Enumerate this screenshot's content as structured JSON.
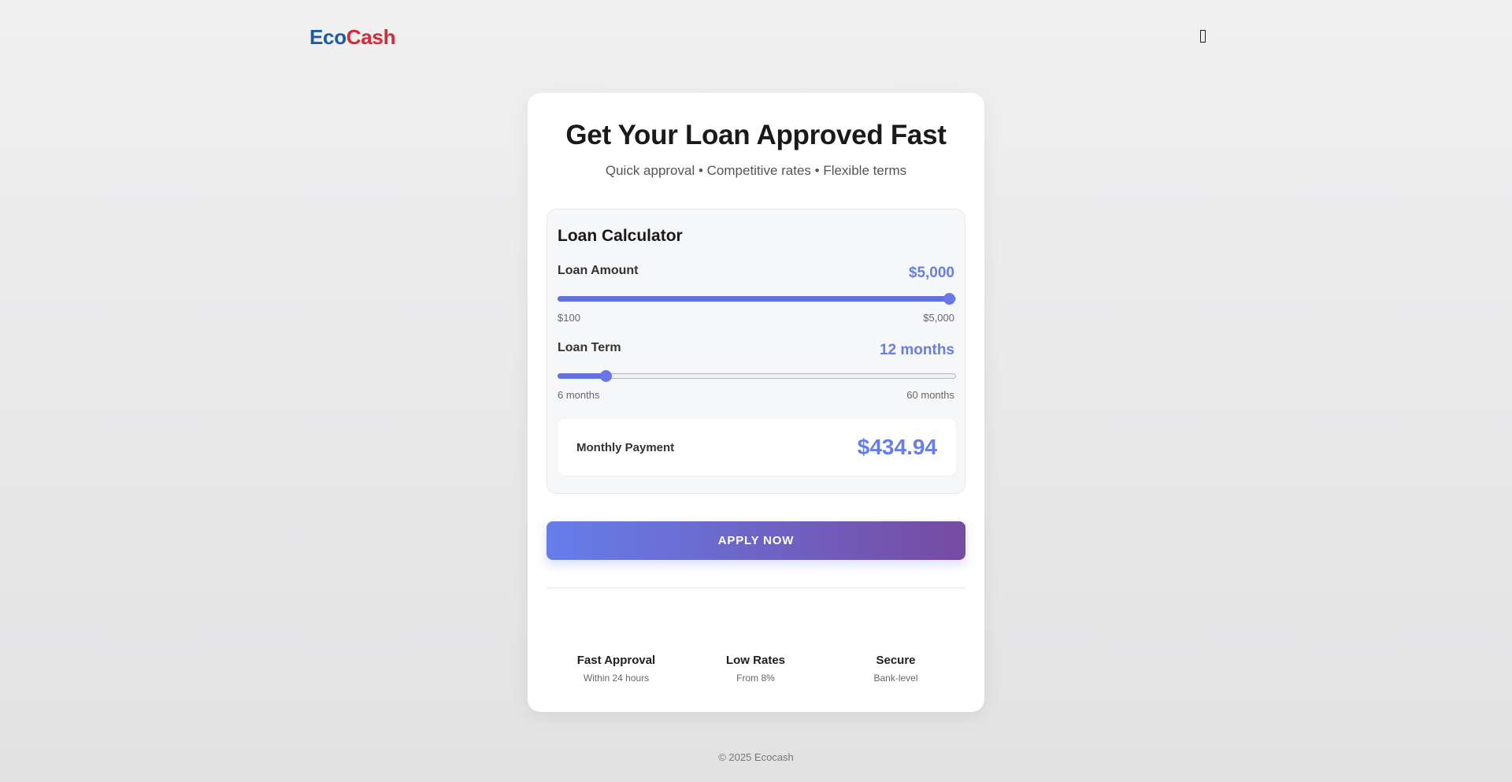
{
  "header": {
    "logo_part1": "Eco",
    "logo_part2": "Cash",
    "menu_icon": "menu-icon"
  },
  "hero": {
    "title": "Get Your Loan Approved Fast",
    "subtitle": "Quick approval • Competitive rates • Flexible terms"
  },
  "calculator": {
    "title": "Loan Calculator",
    "amount": {
      "label": "Loan Amount",
      "value": "$5,000",
      "min_label": "$100",
      "max_label": "$5,000",
      "min": 100,
      "max": 5000,
      "current": 5000
    },
    "term": {
      "label": "Loan Term",
      "value": "12 months",
      "min_label": "6 months",
      "max_label": "60 months",
      "min": 6,
      "max": 60,
      "current": 12
    },
    "payment": {
      "label": "Monthly Payment",
      "value": "$434.94"
    }
  },
  "apply_button": "APPLY NOW",
  "features": [
    {
      "title": "Fast Approval",
      "subtitle": "Within 24 hours"
    },
    {
      "title": "Low Rates",
      "subtitle": "From 8%"
    },
    {
      "title": "Secure",
      "subtitle": "Bank-level"
    }
  ],
  "footer": "© 2025 Ecocash",
  "colors": {
    "accent": "#667eea",
    "gradient_end": "#764ba2",
    "logo_blue": "#1d5aa6",
    "logo_red": "#d42a36"
  }
}
